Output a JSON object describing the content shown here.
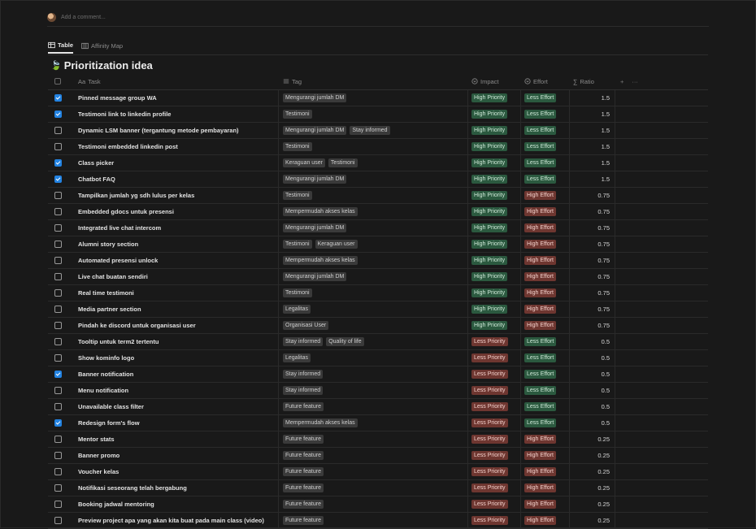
{
  "comment": {
    "placeholder": "Add a comment..."
  },
  "views": [
    {
      "label": "Table",
      "icon": "table-icon",
      "active": true
    },
    {
      "label": "Affinity Map",
      "icon": "board-icon",
      "active": false
    }
  ],
  "database": {
    "emoji": "🍃",
    "title": "Prioritization idea"
  },
  "columns": {
    "task": "Task",
    "task_prefix": "Aa",
    "tag": "Tag",
    "impact": "Impact",
    "effort": "Effort",
    "ratio": "Ratio",
    "ratio_prefix": "∑",
    "add": "+",
    "more": "···"
  },
  "colors": {
    "background": "#191919",
    "checkbox_checked": "#2383e2",
    "green_pill": "#2b593f",
    "red_pill": "#6e3630",
    "tag_pill": "#3a3a3a"
  },
  "rows": [
    {
      "checked": true,
      "task": "Pinned message group WA",
      "tags": [
        "Mengurangi jumlah DM"
      ],
      "impact": "High Priority",
      "effort": "Less Effort",
      "ratio": "1.5"
    },
    {
      "checked": true,
      "task": "Testimoni link to linkedin profile",
      "tags": [
        "Testimoni"
      ],
      "impact": "High Priority",
      "effort": "Less Effort",
      "ratio": "1.5"
    },
    {
      "checked": false,
      "task": "Dynamic LSM banner (tergantung metode pembayaran)",
      "tags": [
        "Mengurangi jumlah DM",
        "Stay informed"
      ],
      "impact": "High Priority",
      "effort": "Less Effort",
      "ratio": "1.5"
    },
    {
      "checked": false,
      "task": "Testimoni embedded linkedin post",
      "tags": [
        "Testimoni"
      ],
      "impact": "High Priority",
      "effort": "Less Effort",
      "ratio": "1.5"
    },
    {
      "checked": true,
      "task": "Class picker",
      "tags": [
        "Keraguan user",
        "Testimoni"
      ],
      "impact": "High Priority",
      "effort": "Less Effort",
      "ratio": "1.5"
    },
    {
      "checked": true,
      "task": "Chatbot FAQ",
      "tags": [
        "Mengurangi jumlah DM"
      ],
      "impact": "High Priority",
      "effort": "Less Effort",
      "ratio": "1.5"
    },
    {
      "checked": false,
      "task": "Tampilkan jumlah yg sdh lulus per kelas",
      "tags": [
        "Testimoni"
      ],
      "impact": "High Priority",
      "effort": "High Effort",
      "ratio": "0.75"
    },
    {
      "checked": false,
      "task": "Embedded gdocs untuk presensi",
      "tags": [
        "Mempermudah akses kelas"
      ],
      "impact": "High Priority",
      "effort": "High Effort",
      "ratio": "0.75"
    },
    {
      "checked": false,
      "task": "Integrated live chat intercom",
      "tags": [
        "Mengurangi jumlah DM"
      ],
      "impact": "High Priority",
      "effort": "High Effort",
      "ratio": "0.75"
    },
    {
      "checked": false,
      "task": "Alumni story section",
      "tags": [
        "Testimoni",
        "Keraguan user"
      ],
      "impact": "High Priority",
      "effort": "High Effort",
      "ratio": "0.75"
    },
    {
      "checked": false,
      "task": "Automated presensi unlock",
      "tags": [
        "Mempermudah akses kelas"
      ],
      "impact": "High Priority",
      "effort": "High Effort",
      "ratio": "0.75"
    },
    {
      "checked": false,
      "task": "Live chat buatan sendiri",
      "tags": [
        "Mengurangi jumlah DM"
      ],
      "impact": "High Priority",
      "effort": "High Effort",
      "ratio": "0.75"
    },
    {
      "checked": false,
      "task": "Real time testimoni",
      "tags": [
        "Testimoni"
      ],
      "impact": "High Priority",
      "effort": "High Effort",
      "ratio": "0.75"
    },
    {
      "checked": false,
      "task": "Media partner section",
      "tags": [
        "Legalitas"
      ],
      "impact": "High Priority",
      "effort": "High Effort",
      "ratio": "0.75"
    },
    {
      "checked": false,
      "task": "Pindah ke discord untuk organisasi user",
      "tags": [
        "Organisasi User"
      ],
      "impact": "High Priority",
      "effort": "High Effort",
      "ratio": "0.75"
    },
    {
      "checked": false,
      "task": "Tooltip untuk term2 tertentu",
      "tags": [
        "Stay informed",
        "Quality of life"
      ],
      "impact": "Less Priority",
      "effort": "Less Effort",
      "ratio": "0.5"
    },
    {
      "checked": false,
      "task": "Show kominfo logo",
      "tags": [
        "Legalitas"
      ],
      "impact": "Less Priority",
      "effort": "Less Effort",
      "ratio": "0.5"
    },
    {
      "checked": true,
      "task": "Banner notification",
      "tags": [
        "Stay informed"
      ],
      "impact": "Less Priority",
      "effort": "Less Effort",
      "ratio": "0.5"
    },
    {
      "checked": false,
      "task": "Menu notification",
      "tags": [
        "Stay informed"
      ],
      "impact": "Less Priority",
      "effort": "Less Effort",
      "ratio": "0.5"
    },
    {
      "checked": false,
      "task": "Unavailable class filter",
      "tags": [
        "Future feature"
      ],
      "impact": "Less Priority",
      "effort": "Less Effort",
      "ratio": "0.5"
    },
    {
      "checked": true,
      "task": "Redesign form's flow",
      "tags": [
        "Mempermudah akses kelas"
      ],
      "impact": "Less Priority",
      "effort": "Less Effort",
      "ratio": "0.5"
    },
    {
      "checked": false,
      "task": "Mentor stats",
      "tags": [
        "Future feature"
      ],
      "impact": "Less Priority",
      "effort": "High Effort",
      "ratio": "0.25"
    },
    {
      "checked": false,
      "task": "Banner promo",
      "tags": [
        "Future feature"
      ],
      "impact": "Less Priority",
      "effort": "High Effort",
      "ratio": "0.25"
    },
    {
      "checked": false,
      "task": "Voucher kelas",
      "tags": [
        "Future feature"
      ],
      "impact": "Less Priority",
      "effort": "High Effort",
      "ratio": "0.25"
    },
    {
      "checked": false,
      "task": "Notifikasi seseorang telah bergabung",
      "tags": [
        "Future feature"
      ],
      "impact": "Less Priority",
      "effort": "High Effort",
      "ratio": "0.25"
    },
    {
      "checked": false,
      "task": "Booking jadwal mentoring",
      "tags": [
        "Future feature"
      ],
      "impact": "Less Priority",
      "effort": "High Effort",
      "ratio": "0.25"
    },
    {
      "checked": false,
      "task": "Preview project apa yang akan kita buat pada main class (video)",
      "tags": [
        "Future feature"
      ],
      "impact": "Less Priority",
      "effort": "High Effort",
      "ratio": "0.25"
    }
  ]
}
